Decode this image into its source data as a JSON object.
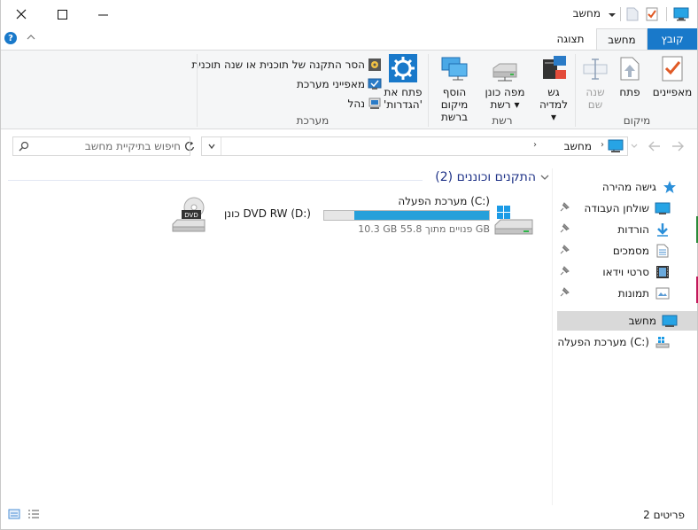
{
  "window": {
    "title": "מחשב",
    "controls": {
      "minimize": "minimize-icon",
      "maximize": "maximize-icon",
      "close": "close-icon"
    }
  },
  "ribbon_tabs": [
    {
      "label": "קובץ",
      "state": "file"
    },
    {
      "label": "מחשב",
      "state": "active"
    },
    {
      "label": "תצוגה",
      "state": "normal"
    }
  ],
  "ribbon": {
    "location_group": {
      "label": "מיקום",
      "properties": "מאפיינים",
      "open": "פתח",
      "rename_line1": "שנה",
      "rename_line2": "שם"
    },
    "network_group": {
      "label": "רשת",
      "media_line1": "גש",
      "media_line2": "למדיה",
      "map_line1": "מפה כונן",
      "map_line2": "רשת",
      "addloc_line1": "הוסף מיקום",
      "addloc_line2": "ברשת"
    },
    "system_group": {
      "label": "מערכת",
      "settings_line1": "פתח את",
      "settings_line2": "'הגדרות'",
      "uninstall": "הסר התקנה של תוכנית או שנה תוכנית",
      "sysprops": "מאפייני מערכת",
      "manage": "נהל"
    }
  },
  "address": {
    "crumb": "מחשב",
    "search_placeholder": "חיפוש בתיקיית מחשב"
  },
  "nav": {
    "quick_access": "גישה מהירה",
    "desktop": "שולחן העבודה",
    "downloads": "הורדות",
    "documents": "מסמכים",
    "videos": "סרטי וידאו",
    "pictures": "תמונות",
    "computer": "מחשב",
    "c_drive": "מערכת הפעלה (C:)"
  },
  "content": {
    "group_title": "התקנים וכוננים (2)",
    "drives": [
      {
        "name": "מערכת הפעלה (C:)",
        "free_text": "10.3 GB פנויים מתוך 55.8 GB",
        "used_fraction": 0.815
      },
      {
        "name": "כונן DVD RW (D:)"
      }
    ]
  },
  "status": {
    "items": "2 פריטים"
  },
  "colors": {
    "accent": "#1979ca",
    "bar_fill": "#26a0da",
    "bar_bg": "#e6e6e6",
    "group_header": "#1e3287"
  }
}
